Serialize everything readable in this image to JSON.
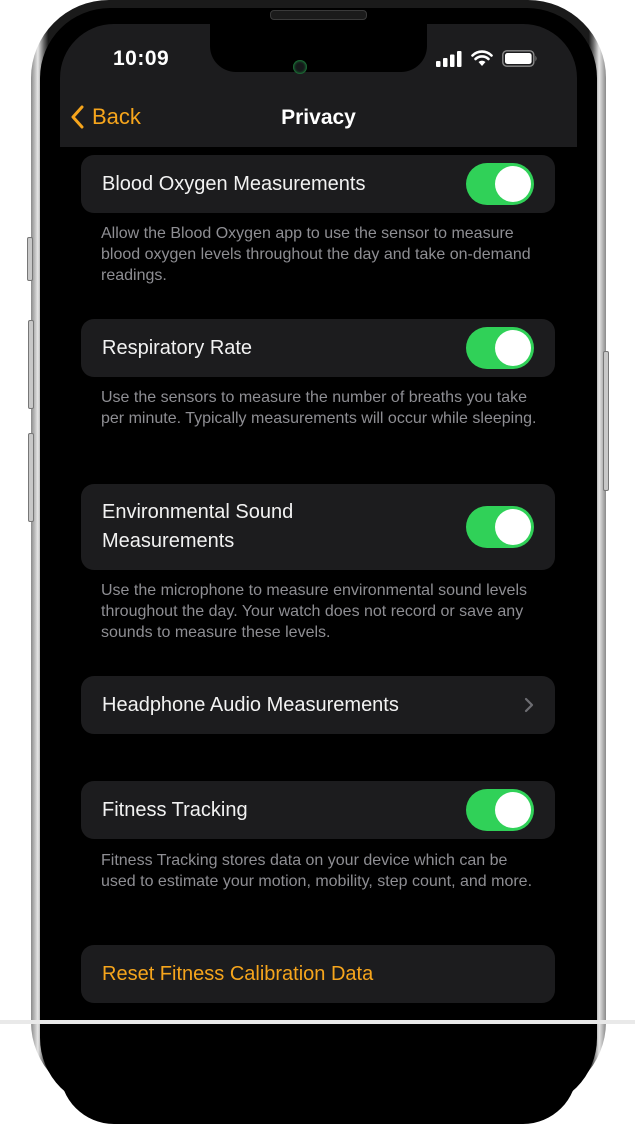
{
  "status_bar": {
    "time": "10:09",
    "icons": [
      "cellular-signal-icon",
      "wifi-icon",
      "battery-icon"
    ]
  },
  "nav": {
    "back_label": "Back",
    "back_icon": "chevron-left-icon",
    "title": "Privacy"
  },
  "settings": [
    {
      "label": "Blood Oxygen Measurements",
      "type": "toggle",
      "on": true,
      "description": "Allow the Blood Oxygen app to use the sensor to measure blood oxygen levels throughout the day and take on-demand readings."
    },
    {
      "label": "Respiratory Rate",
      "type": "toggle",
      "on": true,
      "description": "Use the sensors to measure the number of breaths you take per minute. Typically measurements will occur while sleeping."
    },
    {
      "label_line1": "Environmental Sound",
      "label_line2": "Measurements",
      "type": "toggle",
      "on": true,
      "description": "Use the microphone to measure environmental sound levels throughout the day. Your watch does not record or save any sounds to measure these levels."
    },
    {
      "label": "Headphone Audio Measurements",
      "type": "disclosure",
      "icon": "chevron-right-icon"
    },
    {
      "label": "Fitness Tracking",
      "type": "toggle",
      "on": true,
      "description": "Fitness Tracking stores data on your device which can be used to estimate your motion, mobility, step count, and more."
    },
    {
      "label": "Reset Fitness Calibration Data",
      "type": "action"
    }
  ],
  "colors": {
    "accent": "#f6a51c",
    "toggle_on": "#30d158",
    "cell_bg": "#1c1c1e",
    "secondary_text": "#8e8e93"
  }
}
